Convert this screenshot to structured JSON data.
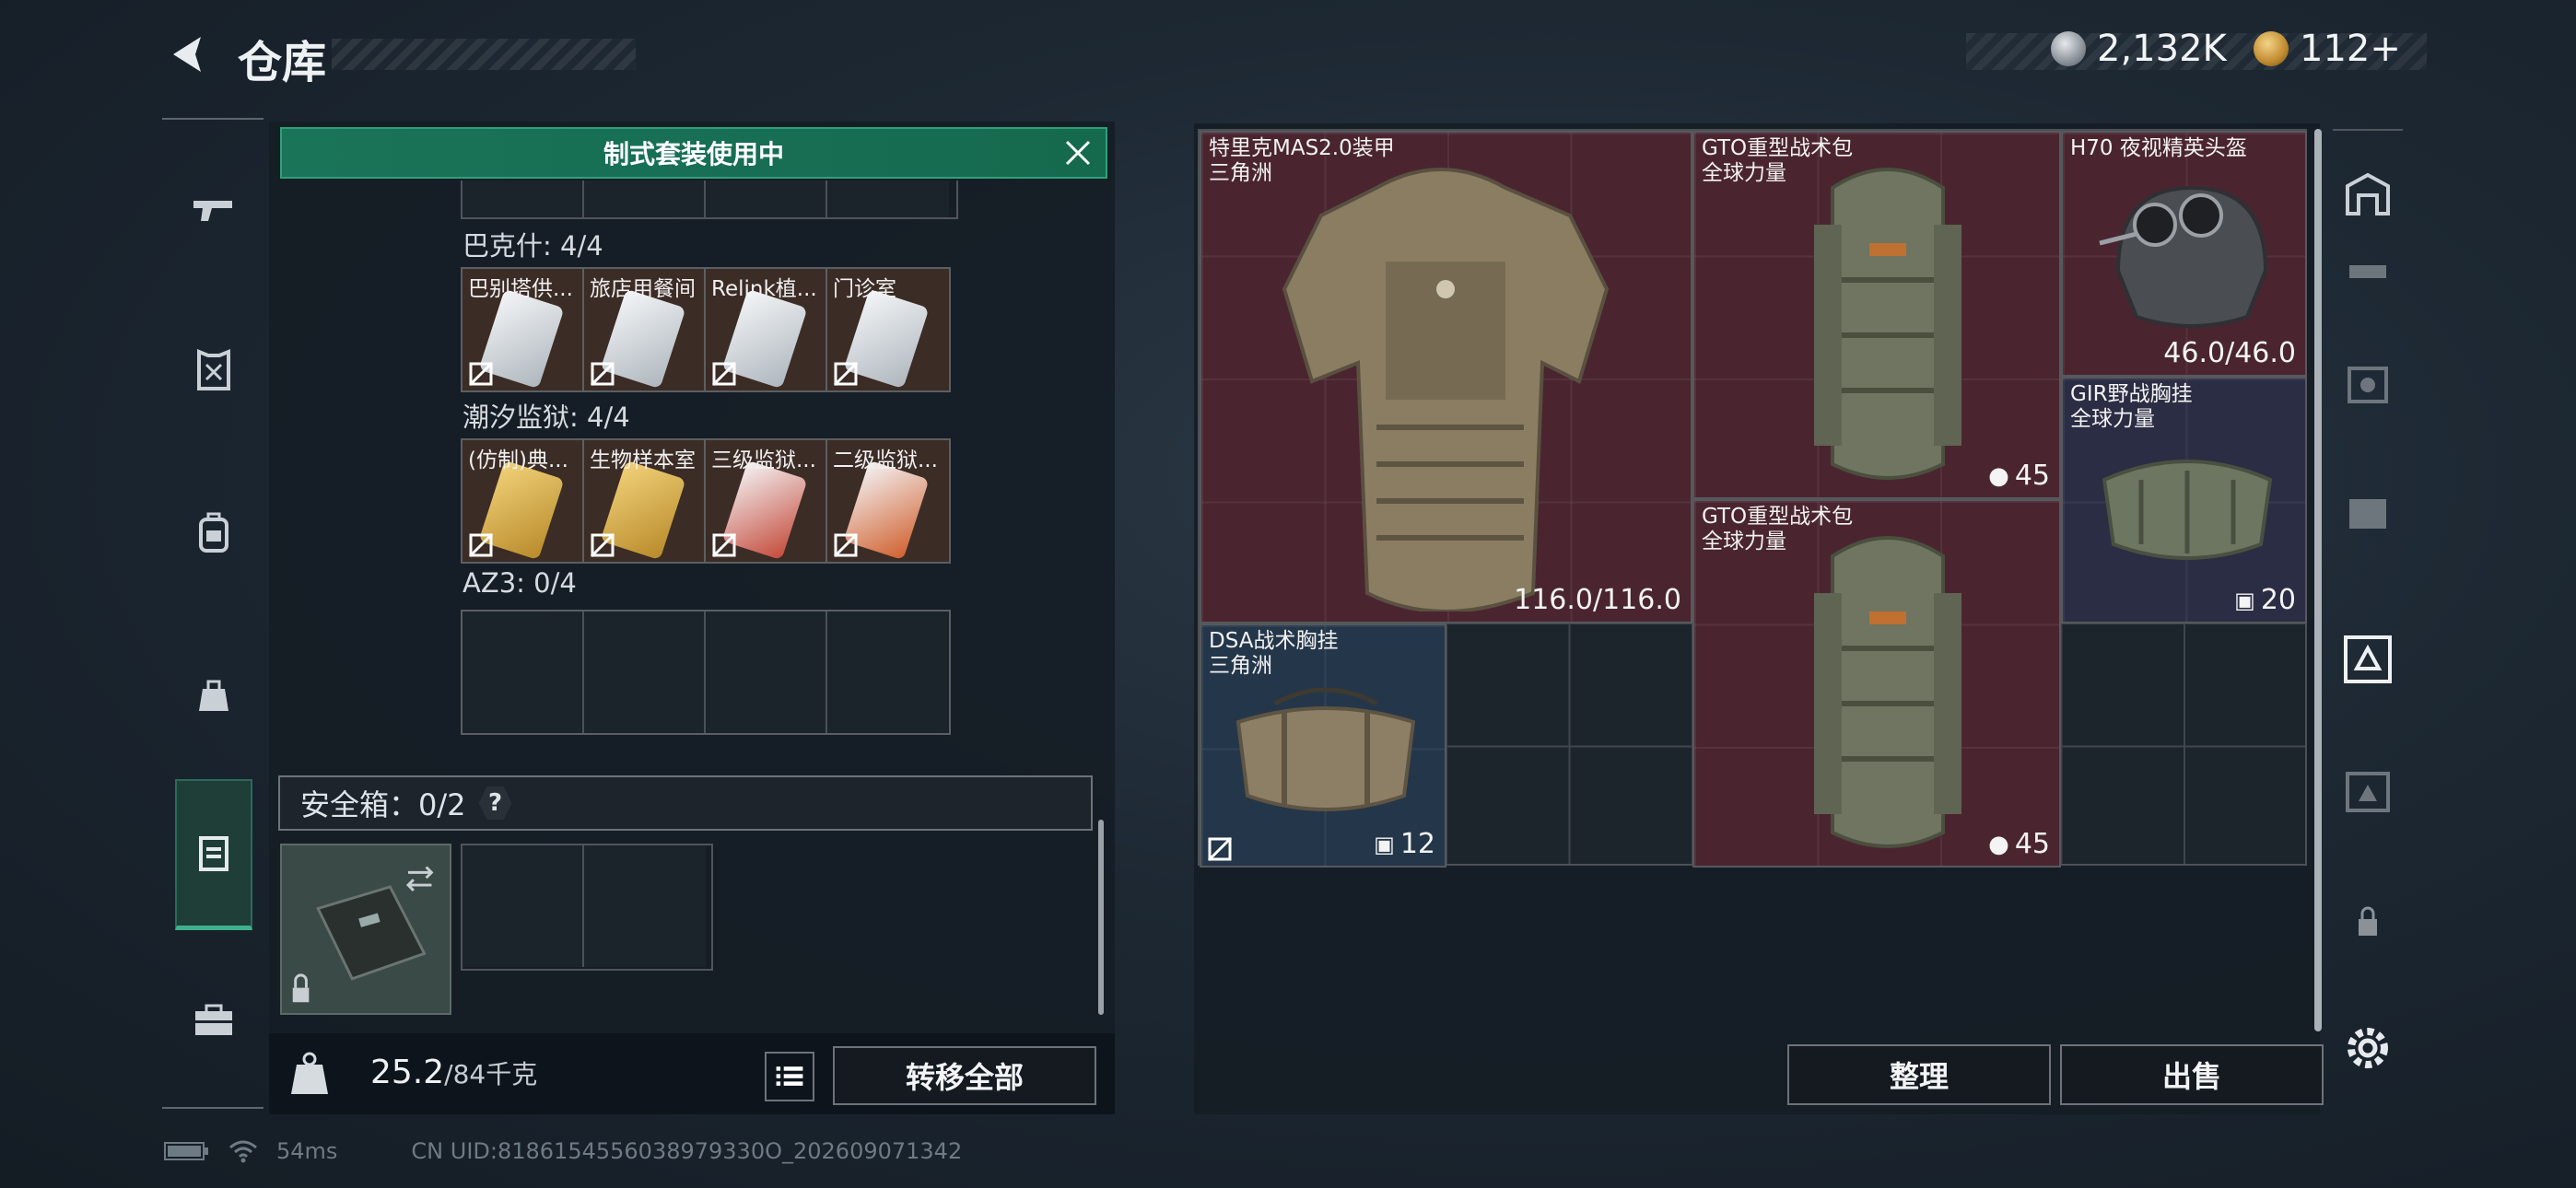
{
  "header": {
    "title": "仓库",
    "currency1": "2,132K",
    "currency2": "112+"
  },
  "left_nav": [
    "weapon-icon",
    "armor-icon",
    "backpack-icon",
    "bag-icon",
    "rig-icon",
    "toolbox-icon"
  ],
  "kit_banner": "制式套装使用中",
  "groups": [
    {
      "title": "巴克什: 4/4",
      "cards": [
        "巴别塔供...",
        "旅店用餐间",
        "Relink植...",
        "门诊室"
      ],
      "tint": "silver"
    },
    {
      "title": "潮汐监狱: 4/4",
      "cards": [
        "(仿制)典...",
        "生物样本室",
        "三级监狱...",
        "二级监狱..."
      ],
      "tint": "gold"
    },
    {
      "title": "AZ3: 0/4",
      "cards": []
    }
  ],
  "safe_box": {
    "label": "安全箱：0/2",
    "help": "?"
  },
  "weight": {
    "value": "25.2",
    "max": "/84千克"
  },
  "transfer_all": "转移全部",
  "stash_items": [
    {
      "name": "特里克MAS2.0装甲",
      "origin": "三角洲",
      "value": "116.0/116.0"
    },
    {
      "name": "GTO重型战术包",
      "origin": "全球力量",
      "value": "45"
    },
    {
      "name": "H70 夜视精英头盔",
      "origin": "",
      "value": "46.0/46.0"
    },
    {
      "name": "GIR野战胸挂",
      "origin": "全球力量",
      "value": "20"
    },
    {
      "name": "GTO重型战术包",
      "origin": "全球力量",
      "value": "45"
    },
    {
      "name": "DSA战术胸挂",
      "origin": "三角洲",
      "value": "12"
    }
  ],
  "actions": {
    "sort": "整理",
    "sell": "出售"
  },
  "status_bar": {
    "ping": "54ms",
    "uid": "CN UID:8186154556038979330O_202609071342"
  },
  "colors": {
    "accent_green": "#1a7458",
    "item_red": "#4a2530",
    "item_navy": "#2b2d44",
    "item_steel": "#24364a"
  }
}
